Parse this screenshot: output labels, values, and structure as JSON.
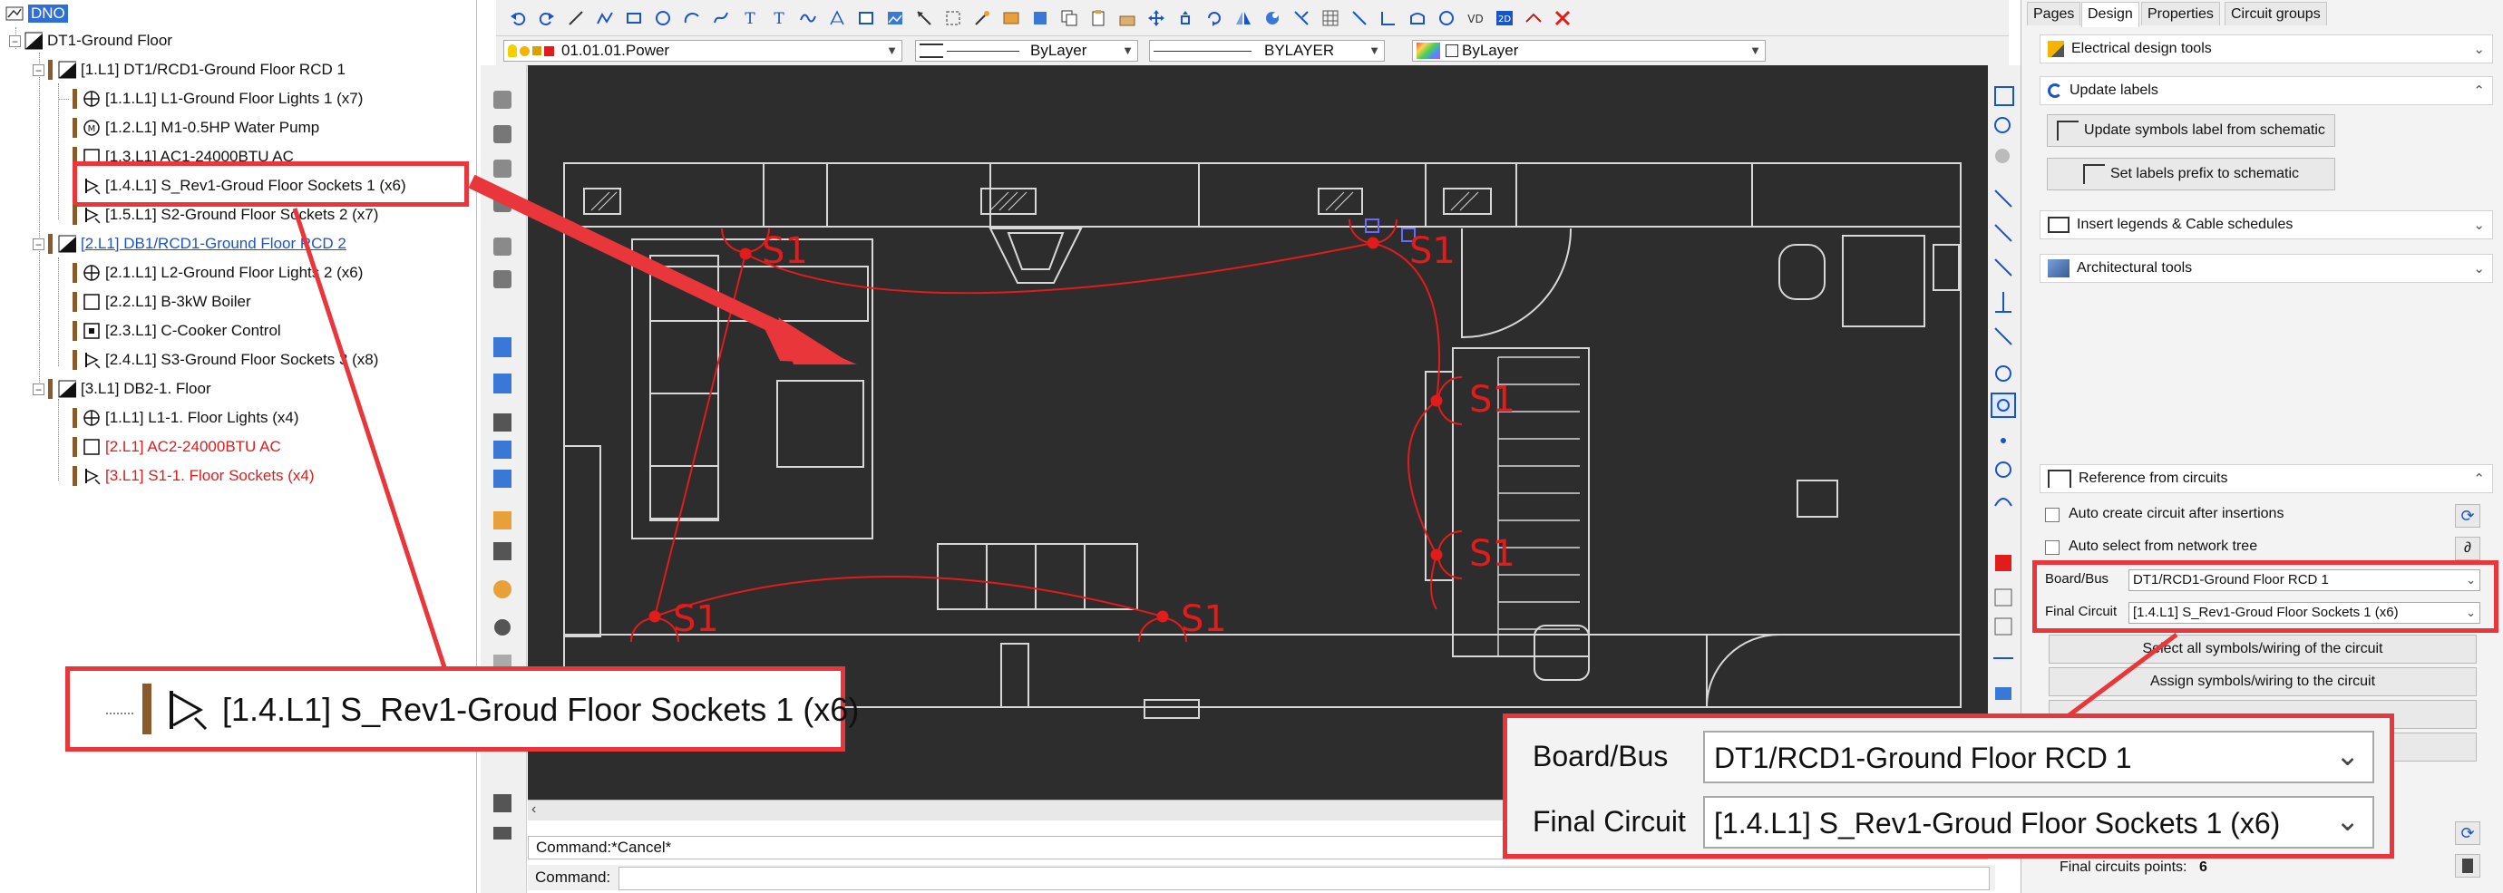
{
  "tree": {
    "root": "DNO",
    "board": "DT1-Ground Floor",
    "nodes": [
      {
        "label": "[1.L1] DT1/RCD1-Ground Floor RCD 1"
      },
      {
        "label": "[1.1.L1] L1-Ground Floor Lights 1 (x7)"
      },
      {
        "label": "[1.2.L1] M1-0.5HP Water Pump"
      },
      {
        "label": "[1.3.L1] AC1-24000BTU AC"
      },
      {
        "label": "[1.4.L1] S_Rev1-Groud Floor Sockets 1 (x6)"
      },
      {
        "label": "[1.5.L1] S2-Ground Floor Sockets 2 (x7)"
      },
      {
        "label": "[2.L1] DB1/RCD1-Ground Floor RCD 2"
      },
      {
        "label": "[2.1.L1] L2-Ground Floor Lights 2 (x6)"
      },
      {
        "label": "[2.2.L1] B-3kW Boiler"
      },
      {
        "label": "[2.3.L1] C-Cooker Control"
      },
      {
        "label": "[2.4.L1] S3-Ground Floor Sockets 3 (x8)"
      },
      {
        "label": "[3.L1] DB2-1. Floor"
      },
      {
        "label": "[1.L1] L1-1. Floor Lights (x4)"
      },
      {
        "label": "[2.L1] AC2-24000BTU AC"
      },
      {
        "label": "[3.L1] S1-1. Floor Sockets (x4)"
      }
    ]
  },
  "toolbar2": {
    "layer": "01.01.01.Power",
    "linetype": "ByLayer",
    "lineweight": "BYLAYER",
    "color": "ByLayer"
  },
  "canvas": {
    "socket_label": "S1"
  },
  "command": {
    "history": "Command:*Cancel*",
    "prompt": "Command:"
  },
  "right_panel": {
    "tabs": [
      "Pages",
      "Design",
      "Properties",
      "Circuit groups"
    ],
    "sections": {
      "electrical": "Electrical design tools",
      "update_labels": "Update labels",
      "insert_legends": "Insert legends & Cable schedules",
      "architectural": "Architectural tools",
      "reference": "Reference from circuits"
    },
    "buttons": {
      "update_symbols": "Update symbols label from schematic",
      "set_prefix": "Set labels prefix to schematic",
      "select_all": "Select all symbols/wiring of the circuit",
      "assign": "Assign symbols/wiring to the circuit"
    },
    "options": {
      "auto_create": "Auto create circuit after insertions",
      "auto_select": "Auto select from network tree"
    },
    "fields": {
      "board_label": "Board/Bus",
      "board_value": "DT1/RCD1-Ground Floor RCD 1",
      "final_label": "Final Circuit",
      "final_value": "[1.4.L1] S_Rev1-Groud Floor Sockets 1 (x6)"
    },
    "points_label": "Final circuits points:",
    "points_value": "6"
  },
  "callouts": {
    "tree_zoom": "[1.4.L1] S_Rev1-Groud Floor Sockets 1 (x6)",
    "board_label": "Board/Bus",
    "board_value": "DT1/RCD1-Ground Floor RCD 1",
    "final_label": "Final Circuit",
    "final_value": "[1.4.L1] S_Rev1-Groud Floor Sockets 1 (x6)"
  },
  "colors": {
    "accent_red": "#e8363a",
    "drawing_red": "#e21b1b",
    "canvas_bg": "#2d2d2d",
    "wall_line": "#d8d8d8"
  }
}
